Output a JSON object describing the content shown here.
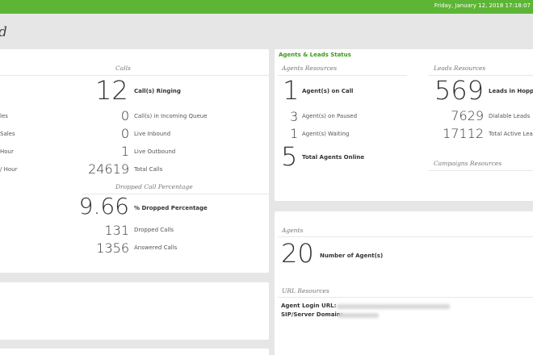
{
  "topbar": {
    "datetime": "Friday, January 12, 2018 17:18:07"
  },
  "page": {
    "title_fragment": "d"
  },
  "calls_panel": {
    "header": "Calls",
    "ringing": {
      "value": "12",
      "label": "Call(s) Ringing"
    },
    "rows": [
      {
        "value": "0",
        "label": "Call(s) in Incoming Queue"
      },
      {
        "value": "0",
        "label": "Live Inbound"
      },
      {
        "value": "1",
        "label": "Live Outbound"
      },
      {
        "value": "24619",
        "label": "Total Calls"
      }
    ],
    "left_cut": [
      "les",
      "Sales",
      "Hour",
      "/ Hour"
    ]
  },
  "dropped_panel": {
    "header": "Dropped Call Percentage",
    "pct": {
      "value": "9.66",
      "label": "% Dropped Percentage"
    },
    "rows": [
      {
        "value": "131",
        "label": "Dropped Calls"
      },
      {
        "value": "1356",
        "label": "Answered Calls"
      }
    ]
  },
  "agents_leads": {
    "title": "Agents & Leads Status",
    "agents_header": "Agents Resources",
    "on_call": {
      "value": "1",
      "label": "Agent(s) on Call"
    },
    "rows": [
      {
        "value": "3",
        "label": "Agent(s) on Paused"
      },
      {
        "value": "1",
        "label": "Agent(s) Waiting"
      }
    ],
    "online": {
      "value": "5",
      "label": "Total Agents Online"
    },
    "leads_header": "Leads Resources",
    "leads_hopper": {
      "value": "569",
      "label": "Leads in Hoppe"
    },
    "leads_rows": [
      {
        "value": "7629",
        "label": "Dialable Leads"
      },
      {
        "value": "17112",
        "label": "Total Active Lea"
      }
    ],
    "campaigns_header": "Campaigns Resources"
  },
  "agents_panel": {
    "header": "Agents",
    "count": {
      "value": "20",
      "label": "Number of Agent(s)"
    },
    "url_header": "URL Resources",
    "login_label": "Agent Login URL:",
    "sip_label": "SIP/Server Domain:"
  }
}
